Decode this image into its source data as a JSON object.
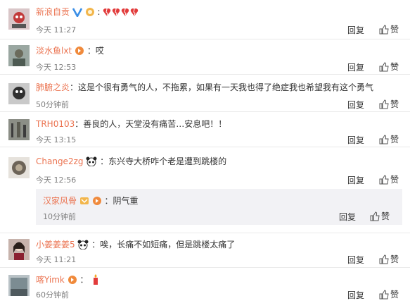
{
  "comments": [
    {
      "nick": "新浪自贡",
      "text": "",
      "time": "今天 11:27"
    },
    {
      "nick": "淡水鱼lxt",
      "text": "：哎",
      "time": "今天 12:53"
    },
    {
      "nick": "肺腑之炎",
      "text": "：这是个很有勇气的人，不拖累，如果有一天我也得了绝症我也希望我有这个勇气",
      "time": "50分钟前"
    },
    {
      "nick": "TRH0103",
      "text": "：善良的人，天堂没有痛苦…安息吧！！",
      "time": "今天 13:15"
    },
    {
      "nick": "Change2zg",
      "text": "：东兴寺大桥咋个老是遭到跳楼的",
      "time": "今天 12:56"
    },
    {
      "nick": "小姜姜姜5",
      "text": "：唉，长痛不如短痛，但是跳楼太痛了",
      "time": "今天 11:21"
    },
    {
      "nick": "喀Yimk",
      "text": "：",
      "time": "60分钟前"
    }
  ],
  "sub_reply": {
    "nick": "汉家风骨",
    "text": "：阴气重",
    "time": "10分钟前"
  },
  "actions": {
    "reply": "回复",
    "like": "赞"
  },
  "colors": {
    "nick": "#eb7350",
    "text": "#333333",
    "time": "#808080",
    "sub_bg": "#f2f2f5"
  }
}
